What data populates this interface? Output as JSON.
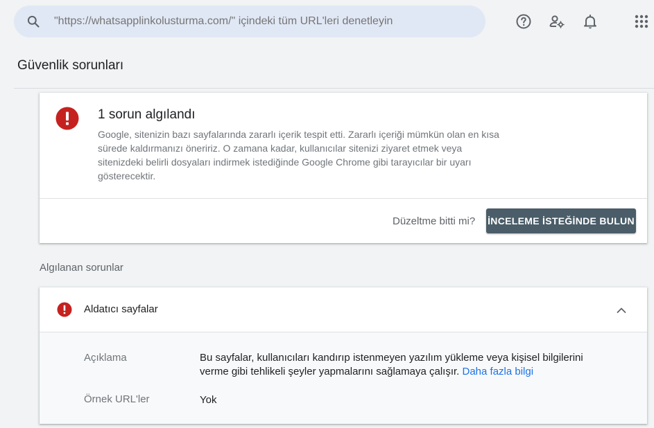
{
  "search": {
    "placeholder": "\"https://whatsapplinkolusturma.com/\" içindeki tüm URL'leri denetleyin",
    "icon": "search-icon"
  },
  "header": {
    "icons": [
      "help-icon",
      "manage-users-icon",
      "notifications-icon",
      "apps-grid-icon"
    ]
  },
  "page": {
    "title": "Güvenlik sorunları"
  },
  "issue_card": {
    "title": "1 sorun algılandı",
    "description": "Google, sitenizin bazı sayfalarında zararlı içerik tespit etti. Zararlı içeriği mümkün olan en kısa sürede kaldırmanızı öneririz. O zamana kadar, kullanıcılar sitenizi ziyaret etmek veya sitenizdeki belirli dosyaları indirmek istediğinde Google Chrome gibi tarayıcılar bir uyarı gösterecektir.",
    "fixed_question": "Düzeltme bitti mi?",
    "review_button": "İNCELEME İSTEĞİNDE BULUN"
  },
  "detected": {
    "section_label": "Algılanan sorunlar",
    "items": [
      {
        "title": "Aldatıcı sayfalar",
        "description_label": "Açıklama",
        "description": "Bu sayfalar, kullanıcıları kandırıp istenmeyen yazılım yükleme veya kişisel bilgilerini verme gibi tehlikeli şeyler yapmalarını sağlamaya çalışır.",
        "learn_more": "Daha fazla bilgi",
        "sample_urls_label": "Örnek URL'ler",
        "sample_urls_value": "Yok"
      }
    ]
  },
  "colors": {
    "error": "#c5221f",
    "button": "#4a5d68",
    "link": "#1a73e8",
    "search_bg": "#e1e8f5"
  }
}
